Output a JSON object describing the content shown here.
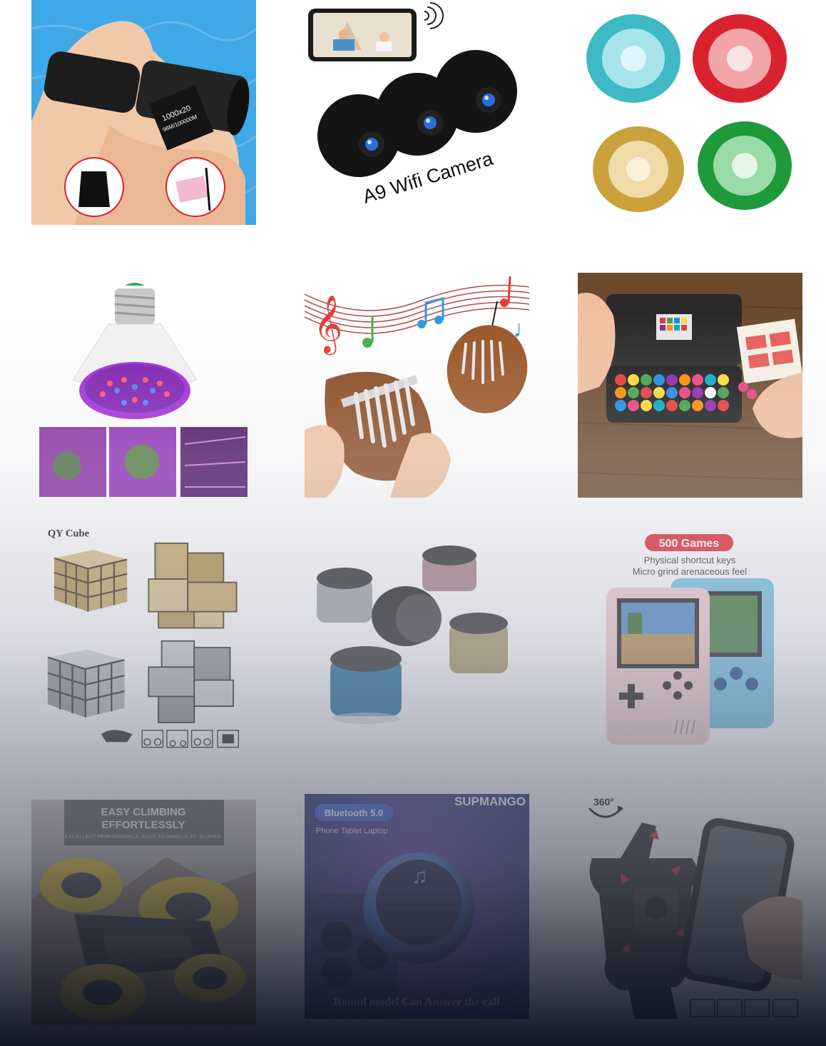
{
  "products": [
    {
      "name": "monocular-telescope",
      "lines": [
        "1000x20",
        "96M/100000M"
      ]
    },
    {
      "name": "wifi-camera",
      "lines": [
        "A9 Wifi Camera"
      ]
    },
    {
      "name": "metal-yoyo",
      "lines": []
    },
    {
      "name": "grow-light-bulb",
      "lines": []
    },
    {
      "name": "mini-kalimba",
      "lines": []
    },
    {
      "name": "bead-puzzle",
      "lines": []
    },
    {
      "name": "mirror-cube",
      "lines": [
        "QY Cube"
      ]
    },
    {
      "name": "mini-speaker",
      "lines": []
    },
    {
      "name": "handheld-game-console",
      "lines": [
        "500 Games",
        "Physical shortcut keys",
        "Micro grind arenaceous feel"
      ]
    },
    {
      "name": "stunt-car",
      "lines": [
        "EASY CLIMBING",
        "EFFORTLESSLY",
        "EXCELLENT PERFORMANCE, EASY TO HANDLE 45° SLOPES."
      ]
    },
    {
      "name": "bluetooth-speaker",
      "lines": [
        "SUPMANGO",
        "Bluetooth 5.0",
        "Phone Tablet Laptop",
        "Round model Can Answer the call"
      ]
    },
    {
      "name": "phone-holder",
      "lines": [
        "360°"
      ]
    }
  ],
  "colors": {
    "pool_blue": "#3fa8e6",
    "camera_black": "#141414",
    "yoyo_teal": "#3fb9c4",
    "yoyo_red": "#d8232e",
    "yoyo_gold": "#caa23c",
    "yoyo_green": "#1f9a3a",
    "grow_purple": "#a12ad6",
    "kalimba_wood": "#8a4a22",
    "table_wood": "#6b4a2e",
    "cube_gold": "#b89a52",
    "cube_silver": "#8f9398",
    "console_pink": "#f2cfcf",
    "console_blue": "#6ec3e8",
    "badge_red": "#e3262f"
  }
}
